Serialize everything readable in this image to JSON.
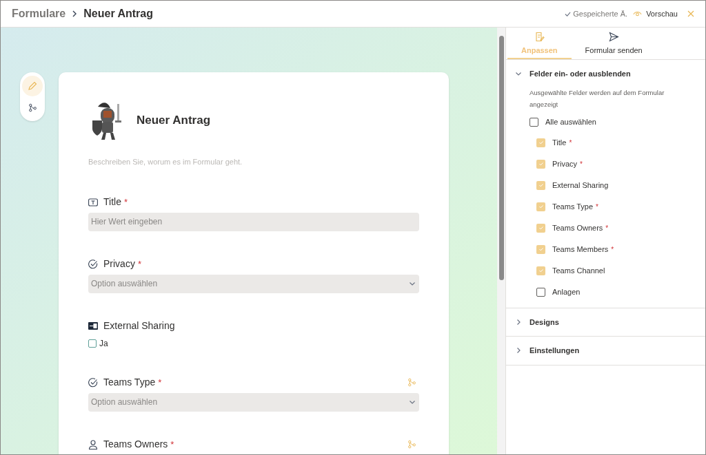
{
  "header": {
    "breadcrumb": "Formulare",
    "title": "Neuer Antrag",
    "saved": "Gespeicherte Ä.",
    "preview": "Vorschau"
  },
  "form": {
    "title": "Neuer Antrag",
    "description": "Beschreiben Sie, worum es im Formular geht.",
    "fields": [
      {
        "kind": "text",
        "label": "Title",
        "required_mark": "*",
        "branching": false,
        "placeholder": "Hier Wert eingeben"
      },
      {
        "kind": "choice",
        "label": "Privacy",
        "required_mark": "*",
        "branching": false,
        "placeholder": "Option auswählen"
      },
      {
        "kind": "yesno",
        "label": "External Sharing",
        "branching": false,
        "option": "Ja",
        "checked": false
      },
      {
        "kind": "choice",
        "label": "Teams Type",
        "required_mark": "*",
        "branching": true,
        "placeholder": "Option auswählen"
      },
      {
        "kind": "person",
        "label": "Teams Owners",
        "required_mark": "*",
        "branching": true
      }
    ]
  },
  "tabs": [
    {
      "label": "Anpassen",
      "selected": true
    },
    {
      "label": "Formular senden",
      "selected": false
    }
  ],
  "sections": [
    {
      "title": "Felder ein- oder ausblenden",
      "expanded": true,
      "hint": "Ausgewählte Felder werden auf dem Formular angezeigt",
      "select_all": {
        "label": "Alle auswählen",
        "checked": false
      },
      "items": [
        {
          "label": "Title",
          "required_mark": "*",
          "checked": true
        },
        {
          "label": "Privacy",
          "required_mark": "*",
          "checked": true
        },
        {
          "label": "External Sharing",
          "checked": true
        },
        {
          "label": "Teams Type",
          "required_mark": "*",
          "checked": true
        },
        {
          "label": "Teams Owners",
          "required_mark": "*",
          "checked": true
        },
        {
          "label": "Teams Members",
          "required_mark": "*",
          "checked": true
        },
        {
          "label": "Teams Channel",
          "checked": true
        },
        {
          "label": "Anlagen",
          "checked": false
        }
      ]
    },
    {
      "title": "Designs",
      "expanded": false
    },
    {
      "title": "Einstellungen",
      "expanded": false
    }
  ]
}
